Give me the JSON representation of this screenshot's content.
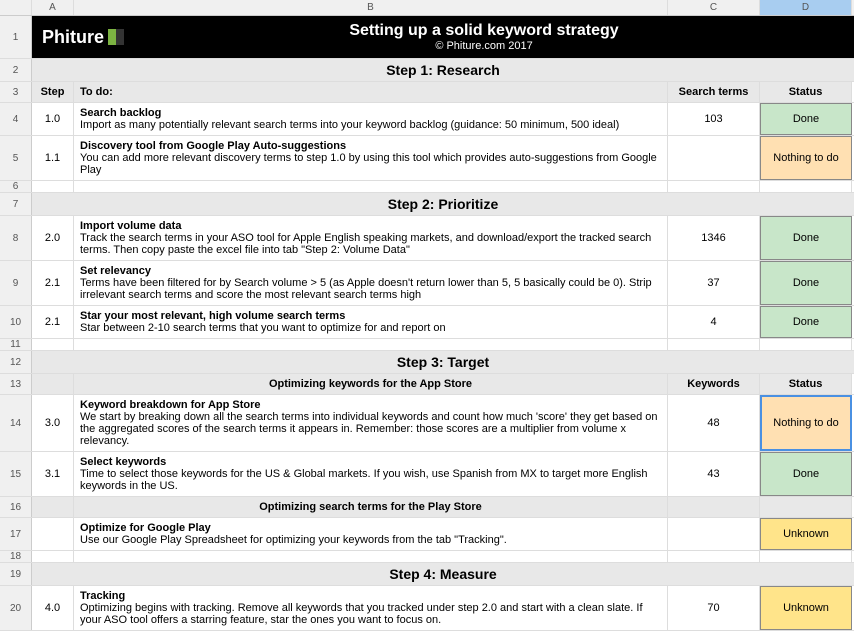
{
  "cols": [
    "A",
    "B",
    "C",
    "D"
  ],
  "banner": {
    "logo": "Phiture",
    "title": "Setting up a solid keyword strategy",
    "subtitle": "© Phiture.com 2017"
  },
  "sections": {
    "s1": "Step 1: Research",
    "s2": "Step 2: Prioritize",
    "s3": "Step 3: Target",
    "s4": "Step 4: Measure"
  },
  "headers": {
    "step": "Step",
    "todo": "To do:",
    "searchterms": "Search terms",
    "status": "Status",
    "keywords": "Keywords",
    "optAppStore": "Optimizing keywords for the App Store",
    "optPlayStore": "Optimizing search terms for the Play Store"
  },
  "rows": {
    "r4": {
      "step": "1.0",
      "title": "Search backlog",
      "desc": "Import as many potentially relevant search terms into your keyword backlog (guidance: 50 minimum, 500 ideal)",
      "c": "103",
      "status": "Done"
    },
    "r5": {
      "step": "1.1",
      "title": "Discovery tool from Google Play Auto-suggestions",
      "desc": "You can add more relevant discovery terms to step 1.0 by using this tool which provides auto-suggestions from Google Play",
      "c": "",
      "status": "Nothing to do"
    },
    "r8": {
      "step": "2.0",
      "title": "Import volume data",
      "desc": "Track the search terms in your ASO tool for Apple English speaking markets, and download/export the tracked search terms. Then copy paste the excel file into tab \"Step 2: Volume Data\"",
      "c": "1346",
      "status": "Done"
    },
    "r9": {
      "step": "2.1",
      "title": "Set relevancy",
      "desc": "Terms have been filtered for by Search volume > 5 (as Apple doesn't return lower than 5, 5 basically could be 0). Strip irrelevant search terms and score the most relevant search terms high",
      "c": "37",
      "status": "Done"
    },
    "r10": {
      "step": "2.1",
      "title": "Star your most relevant, high volume search terms",
      "desc": "Star between 2-10 search terms that you want to optimize for and report on",
      "c": "4",
      "status": "Done"
    },
    "r14": {
      "step": "3.0",
      "title": "Keyword breakdown for App Store",
      "desc": "We start by breaking down all the search terms into individual keywords and count how much 'score' they get based on the aggregated scores of the search terms it appears in. Remember: those scores are a multiplier from volume x relevancy.",
      "c": "48",
      "status": "Nothing to do"
    },
    "r15": {
      "step": "3.1",
      "title": "Select keywords",
      "desc": "Time to select those keywords for the US & Global markets. If you wish, use Spanish from MX to target more English keywords in the US.",
      "c": "43",
      "status": "Done"
    },
    "r17": {
      "step": "",
      "title": "Optimize for Google Play",
      "desc": "Use our Google Play Spreadsheet for optimizing your keywords from the tab \"Tracking\".",
      "c": "",
      "status": "Unknown"
    },
    "r20": {
      "step": "4.0",
      "title": "Tracking",
      "desc": "Optimizing begins with tracking. Remove all keywords that you tracked under step 2.0 and start with a clean slate. If your ASO tool offers a starring feature, star the ones you want to focus on.",
      "c": "70",
      "status": "Unknown"
    }
  }
}
